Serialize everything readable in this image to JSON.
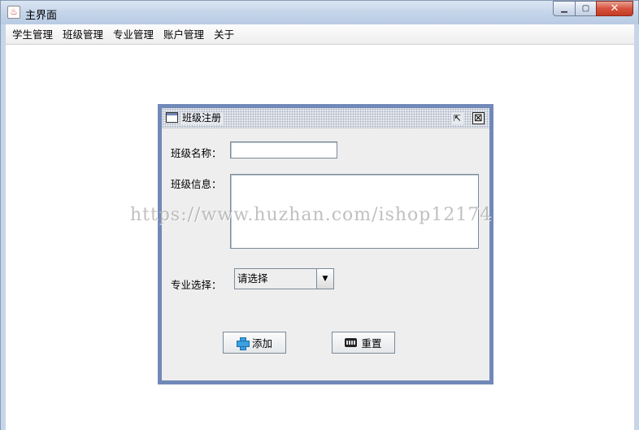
{
  "window": {
    "title": "主界面",
    "app_icon": "java-cup-icon",
    "controls": {
      "minimize": "▁",
      "maximize": "▢",
      "close": "✕"
    }
  },
  "menubar": {
    "items": [
      {
        "label": "学生管理"
      },
      {
        "label": "班级管理"
      },
      {
        "label": "专业管理"
      },
      {
        "label": "账户管理"
      },
      {
        "label": "关于"
      }
    ]
  },
  "dialog": {
    "title": "班级注册",
    "restore_glyph": "⇱",
    "close_glyph": "⊠",
    "class_name_label": "班级名称：",
    "class_name_value": "",
    "class_info_label": "班级信息：",
    "class_info_value": "",
    "major_label": "专业选择：",
    "major_selected": "请选择",
    "add_button": "添加",
    "reset_button": "重置"
  },
  "watermark": "https://www.huzhan.com/ishop12174",
  "colors": {
    "frame_border": "#7189b8",
    "titlebar": "#c6d6ea",
    "panel_bg": "#eeeeee"
  }
}
